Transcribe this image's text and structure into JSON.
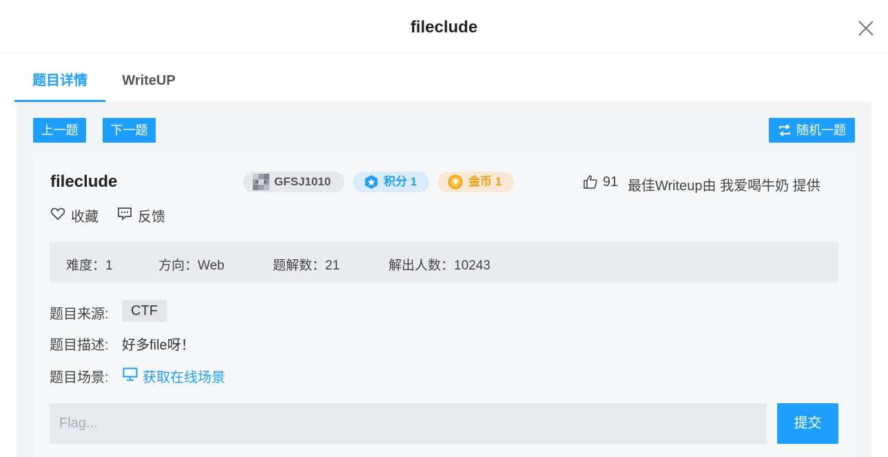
{
  "modal": {
    "title": "fileclude"
  },
  "tabs": [
    {
      "label": "题目详情",
      "active": true
    },
    {
      "label": "WriteUP",
      "active": false
    }
  ],
  "nav": {
    "prev": "上一题",
    "next": "下一题",
    "random": "随机一题"
  },
  "challenge": {
    "title": "fileclude",
    "author": "GFSJ1010",
    "score": "积分 1",
    "gold": "金币 1",
    "likes": "91",
    "best_writeup": "最佳Writeup由 我爱喝牛奶 提供",
    "favorite": "收藏",
    "feedback": "反馈",
    "stats": {
      "difficulty": "难度：1",
      "direction": "方向：Web",
      "solutions": "题解数：21",
      "solvers": "解出人数：10243"
    },
    "source_label": "题目来源:",
    "source": "CTF",
    "desc_label": "题目描述:",
    "desc": "好多file呀！",
    "scene_label": "题目场景:",
    "scene_link": "获取在线场景"
  },
  "flag": {
    "placeholder": "Flag...",
    "value": ""
  },
  "submit": "提交",
  "colors": {
    "accent": "#1e9fff",
    "gold": "#f59a0e"
  }
}
